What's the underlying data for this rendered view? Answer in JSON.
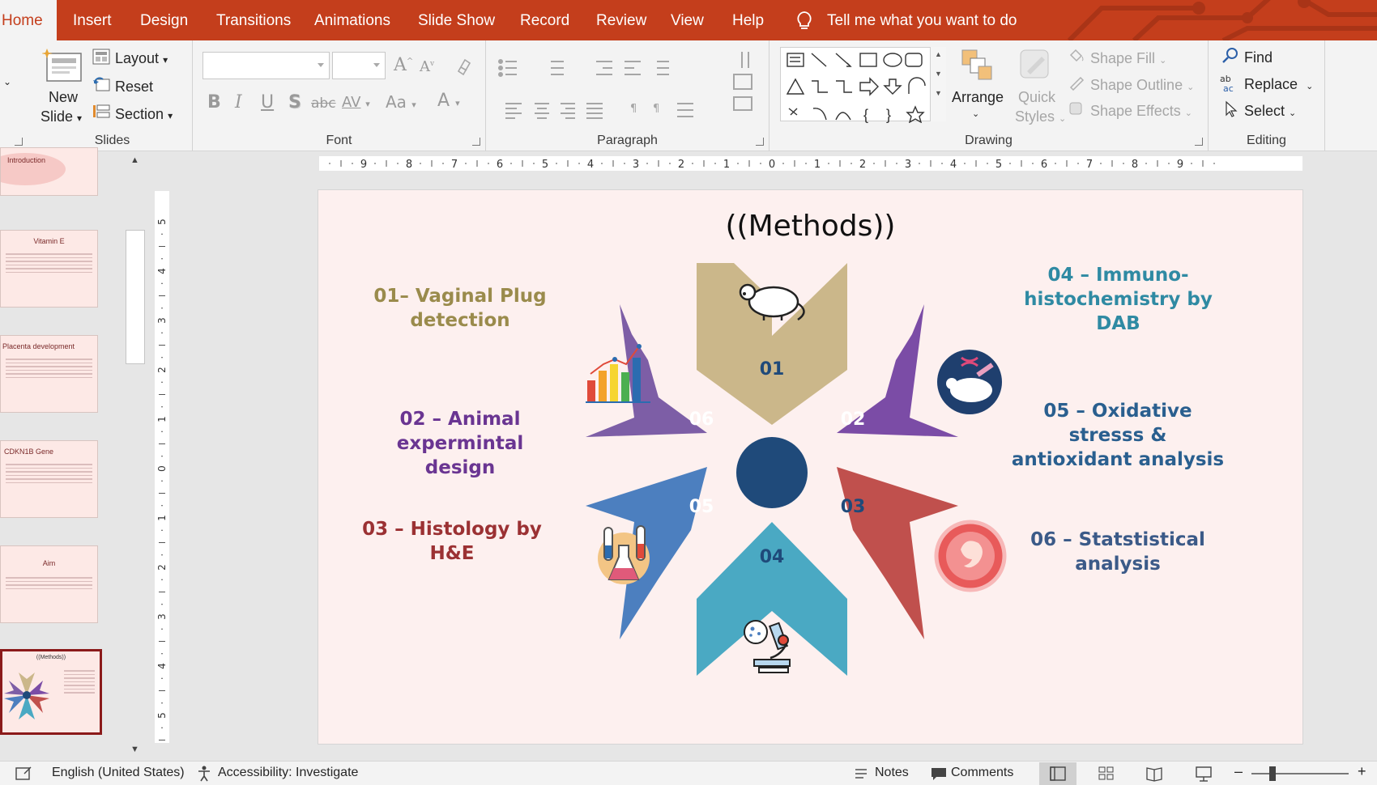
{
  "menu": {
    "tabs": [
      "Home",
      "Insert",
      "Design",
      "Transitions",
      "Animations",
      "Slide Show",
      "Record",
      "Review",
      "View",
      "Help"
    ],
    "tell_me": "Tell me what you want to do"
  },
  "ribbon": {
    "slides": {
      "new_slide_line1": "New",
      "new_slide_line2": "Slide",
      "layout": "Layout",
      "reset": "Reset",
      "section": "Section",
      "label": "Slides"
    },
    "font": {
      "label": "Font",
      "font_name": "",
      "font_size": "",
      "bold": "B",
      "italic": "I",
      "underline": "U",
      "shadow": "S",
      "strike": "abc",
      "spacing": "AV",
      "change_case": "Aa",
      "color": "A"
    },
    "paragraph": {
      "label": "Paragraph"
    },
    "drawing": {
      "label": "Drawing",
      "arrange": "Arrange",
      "quick_styles_line1": "Quick",
      "quick_styles_line2": "Styles",
      "shape_fill": "Shape Fill",
      "shape_outline": "Shape Outline",
      "shape_effects": "Shape Effects"
    },
    "editing": {
      "label": "Editing",
      "find": "Find",
      "replace": "Replace",
      "select": "Select"
    }
  },
  "thumbnails": [
    {
      "title": "Introduction"
    },
    {
      "title": "Vitamin E"
    },
    {
      "title": "Placenta development"
    },
    {
      "title": "CDKN1B Gene"
    },
    {
      "title": "Aim"
    },
    {
      "title": "((Methods))"
    }
  ],
  "hruler_ticks": [
    "9",
    "8",
    "7",
    "6",
    "5",
    "4",
    "3",
    "2",
    "1",
    "0",
    "1",
    "2",
    "3",
    "4",
    "5",
    "6",
    "7",
    "8",
    "9"
  ],
  "vruler_ticks": [
    "5",
    "4",
    "3",
    "2",
    "1",
    "0",
    "1",
    "2",
    "3",
    "4",
    "5"
  ],
  "slide": {
    "title": "((Methods))",
    "star_numbers": [
      "01",
      "02",
      "03",
      "04",
      "05",
      "06"
    ],
    "left_items": [
      {
        "line1": "01– Vaginal Plug",
        "line2": "detection",
        "color": "#9a8b4c"
      },
      {
        "line1": "02 – Animal",
        "line2": "expermintal design",
        "color": "#6a3592"
      },
      {
        "line1": "03 – Histology by",
        "line2": "H&E",
        "color": "#9b3133"
      }
    ],
    "right_items": [
      {
        "line1": "04 – Immuno-",
        "line2": "histochemistry  by",
        "line3": "DAB",
        "color": "#2f8aa3"
      },
      {
        "line1": "05 – Oxidative",
        "line2": "stresss &",
        "line3": "antioxidant analysis",
        "color": "#2a5f8f"
      },
      {
        "line1": "06 – Statstistical",
        "line2": "analysis",
        "line3": "",
        "color": "#3b5a88"
      }
    ],
    "colors": {
      "arrow1": "#cbb78a",
      "arrow2": "#7b4ca6",
      "arrow3": "#c0504d",
      "arrow4": "#4aa9c3",
      "arrow5": "#4c7fbf",
      "arrow6": "#7d5ea6",
      "center": "#1f4a7a"
    }
  },
  "status": {
    "language": "English (United States)",
    "accessibility": "Accessibility: Investigate",
    "notes": "Notes",
    "comments": "Comments"
  }
}
